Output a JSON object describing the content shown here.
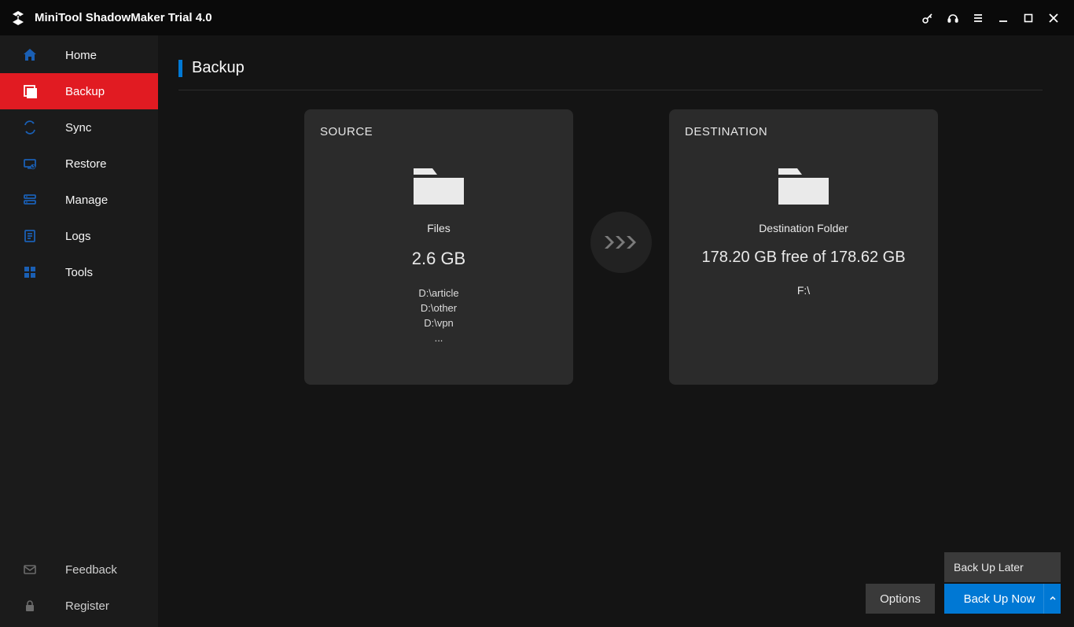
{
  "title": "MiniTool ShadowMaker Trial 4.0",
  "sidebar": {
    "items": [
      {
        "label": "Home"
      },
      {
        "label": "Backup"
      },
      {
        "label": "Sync"
      },
      {
        "label": "Restore"
      },
      {
        "label": "Manage"
      },
      {
        "label": "Logs"
      },
      {
        "label": "Tools"
      }
    ],
    "footer": [
      {
        "label": "Feedback"
      },
      {
        "label": "Register"
      }
    ]
  },
  "page": {
    "title": "Backup"
  },
  "source": {
    "label": "SOURCE",
    "type": "Files",
    "size": "2.6 GB",
    "paths": [
      "D:\\article",
      "D:\\other",
      "D:\\vpn",
      "..."
    ]
  },
  "destination": {
    "label": "DESTINATION",
    "type": "Destination Folder",
    "free_line": "178.20 GB free of 178.62 GB",
    "path": "F:\\"
  },
  "popup": {
    "label": "Back Up Later"
  },
  "actions": {
    "options": "Options",
    "primary": "Back Up Now"
  }
}
